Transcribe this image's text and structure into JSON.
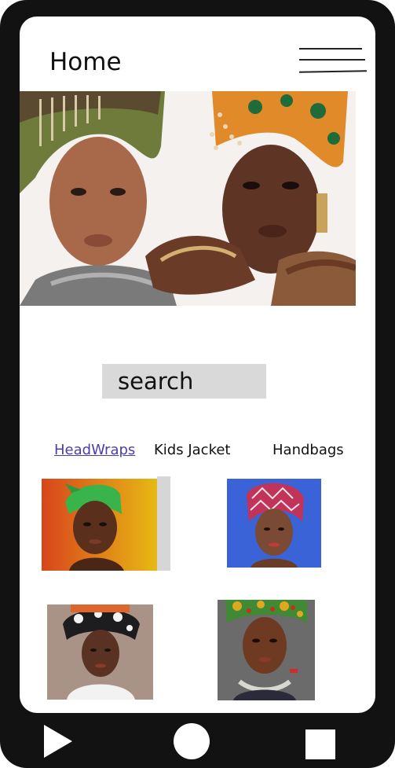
{
  "header": {
    "title": "Home"
  },
  "search": {
    "placeholder": "search"
  },
  "tabs": [
    {
      "label": "HeadWraps",
      "active": true
    },
    {
      "label": "Kids Jacket",
      "active": false
    },
    {
      "label": "Handbags",
      "active": false
    }
  ],
  "products": [
    {
      "icon": "headwrap-photo-green-on-orange"
    },
    {
      "icon": "headwrap-photo-pink-on-blue"
    },
    {
      "icon": "headwrap-photo-patterned-on-taupe"
    },
    {
      "icon": "headwrap-photo-ankara-on-gray"
    }
  ],
  "nav": {
    "back_icon": "play-triangle-icon",
    "home_icon": "circle-icon",
    "recent_icon": "square-icon"
  },
  "colors": {
    "frame": "#121212",
    "active_tab": "#4a3fa8",
    "search_bg": "#d9d9d9"
  }
}
